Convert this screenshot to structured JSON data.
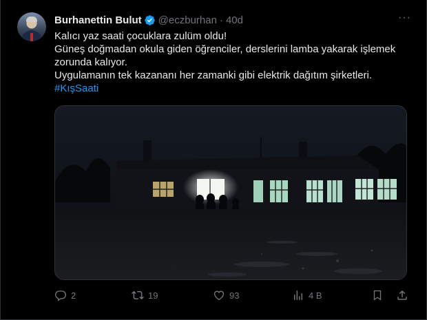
{
  "tweet": {
    "author_name": "Burhanettin Bulut",
    "handle": "@eczburhan",
    "separator": "·",
    "age": "40d",
    "more_label": "···",
    "lines": [
      "Kalıcı yaz saati çocuklara zulüm oldu!",
      "Güneş doğmadan okula giden öğrenciler, derslerini lamba yakarak işlemek",
      "zorunda kalıyor.",
      "Uygulamanın tek kazananı her zamanki gibi elektrik dağıtım şirketleri."
    ],
    "hashtag": "#KışSaati"
  },
  "actions": {
    "replies": "2",
    "retweets": "19",
    "likes": "93",
    "views": "4 B"
  },
  "colors": {
    "background": "#000000",
    "text": "#e7e9ea",
    "muted": "#71767b",
    "link": "#1d9bf0",
    "border": "#2f3336"
  },
  "icons": [
    "verified-badge-icon",
    "more-icon",
    "reply-icon",
    "retweet-icon",
    "like-icon",
    "views-icon",
    "bookmark-icon",
    "share-icon"
  ]
}
